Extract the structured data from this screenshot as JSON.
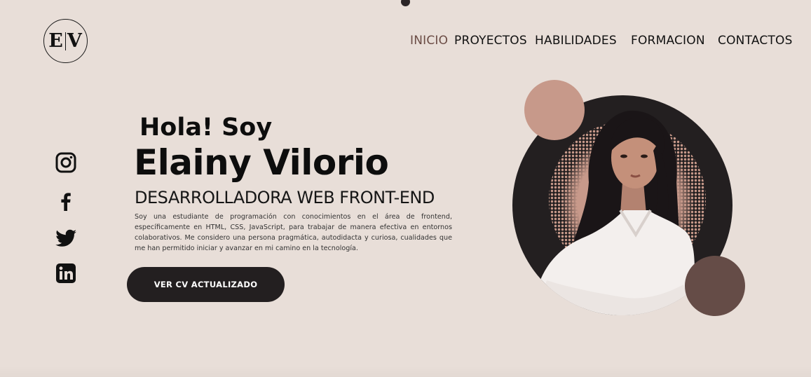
{
  "logo": {
    "left": "E",
    "right": "V"
  },
  "nav": [
    {
      "label": "INICIO",
      "active": true
    },
    {
      "label": "PROYECTOS",
      "active": false
    },
    {
      "label": "HABILIDADES",
      "active": false
    },
    {
      "label": "FORMACION",
      "active": false
    },
    {
      "label": "CONTACTOS",
      "active": false
    }
  ],
  "social": [
    "instagram-icon",
    "facebook-icon",
    "twitter-icon",
    "linkedin-icon"
  ],
  "hero": {
    "greeting": "Hola! Soy",
    "name": "Elainy Vilorio",
    "role": "DESARROLLADORA WEB FRONT-END",
    "bio": "Soy una estudiante de programación con conocimientos en el área de frontend, específicamente en HTML, CSS, JavaScript, para trabajar de manera efectiva en entornos colaborativos. Me considero una persona pragmática, autodidacta y curiosa, cualidades que me han permitido iniciar y avanzar en mi camino en la tecnología.",
    "cta": "VER CV ACTUALIZADO"
  },
  "colors": {
    "background": "#e8ded8",
    "dark": "#231f20",
    "accent_light": "#c7998a",
    "accent_dark": "#654c47",
    "nav_active": "#6b4c45"
  }
}
